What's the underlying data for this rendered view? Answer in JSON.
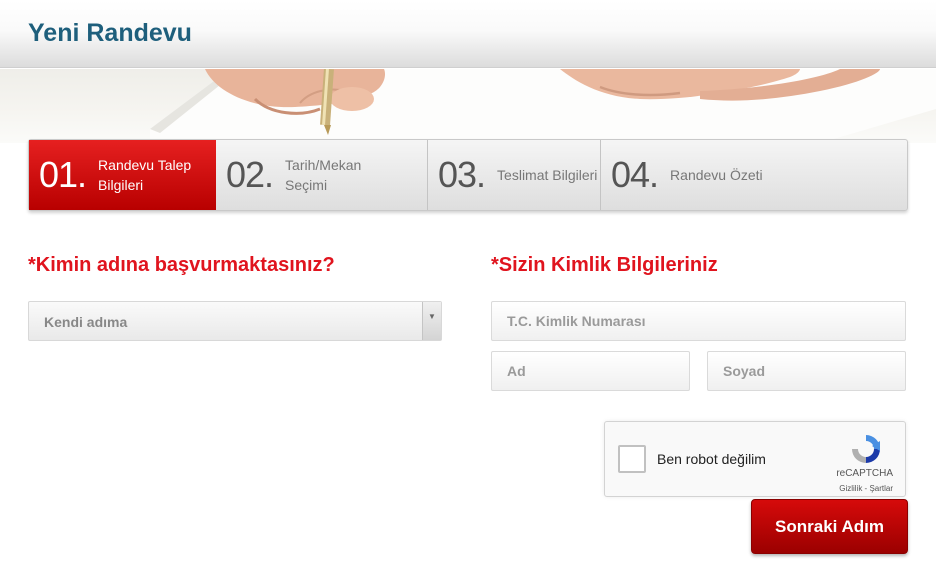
{
  "page": {
    "title": "Yeni Randevu"
  },
  "steps": [
    {
      "number": "01.",
      "label": "Randevu Talep Bilgileri",
      "active": true
    },
    {
      "number": "02.",
      "label": "Tarih/Mekan Seçimi",
      "active": false
    },
    {
      "number": "03.",
      "label": "Teslimat Bilgileri",
      "active": false
    },
    {
      "number": "04.",
      "label": "Randevu Özeti",
      "active": false
    }
  ],
  "applicant": {
    "heading": "*Kimin adına başvurmaktasınız?",
    "select_value": "Kendi adıma"
  },
  "identity": {
    "heading": "*Sizin Kimlik Bilgileriniz",
    "tc_placeholder": "T.C. Kimlik Numarası",
    "first_name_placeholder": "Ad",
    "last_name_placeholder": "Soyad"
  },
  "captcha": {
    "label": "Ben robot değilim",
    "brand": "reCAPTCHA",
    "terms": "Gizlilik - Şartlar"
  },
  "actions": {
    "next_label": "Sonraki Adım"
  },
  "colors": {
    "accent": "#e0141e",
    "title": "#1e5f7c",
    "button": "#c10000"
  }
}
